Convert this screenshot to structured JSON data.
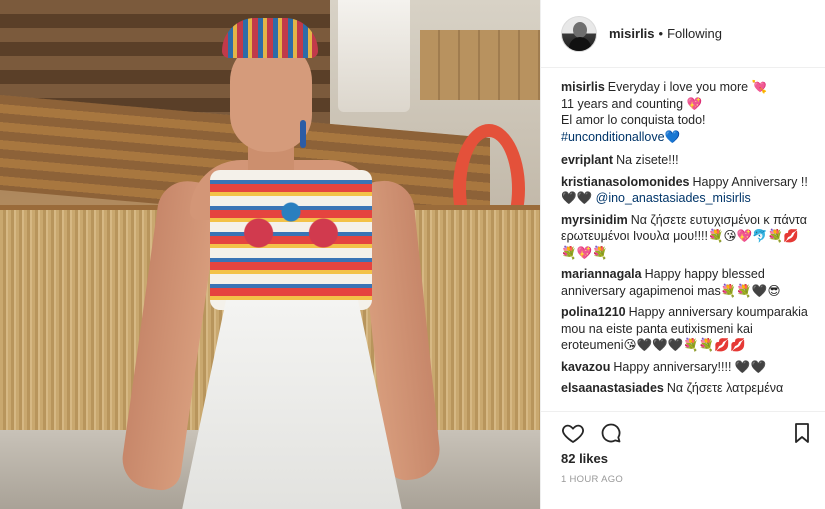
{
  "post": {
    "username": "misirlis",
    "follow_status": "Following",
    "separator": "•"
  },
  "caption": {
    "user": "misirlis",
    "lines": [
      "Everyday i love you more 💘",
      "11 years and counting 💖",
      "El amor lo conquista todo!",
      "#unconditionallove💙"
    ]
  },
  "comments": [
    {
      "user": "evriplant",
      "text": "Na zisete!!!"
    },
    {
      "user": "kristianasolomonides",
      "text": "Happy Anniversary !!",
      "line2": "🖤🖤",
      "mention": "@ino_anastasiades_misirlis"
    },
    {
      "user": "myrsinidim",
      "text": "Να ζήσετε ευτυχισμένοι κ πάντα ερωτευμένοι Ινουλα μου!!!!💐😘💖🐬💐💋💐💖💐"
    },
    {
      "user": "mariannagala",
      "text": "Happy happy blessed anniversary agapimenoi mas💐💐🖤😎"
    },
    {
      "user": "polina1210",
      "text": "Happy anniversary koumparakia mou na eiste panta eutixismeni kai eroteumeni😘🖤🖤🖤💐💐💋💋"
    },
    {
      "user": "kavazou",
      "text": "Happy anniversary!!!! 🖤🖤"
    },
    {
      "user": "elsaanastasiades",
      "text": "Να ζήσετε λατρεμένα"
    }
  ],
  "actions": {
    "like_icon": "heart-outline-icon",
    "comment_icon": "speech-bubble-icon",
    "save_icon": "bookmark-icon"
  },
  "likes_text": "82 likes",
  "timestamp": "1 HOUR AGO"
}
